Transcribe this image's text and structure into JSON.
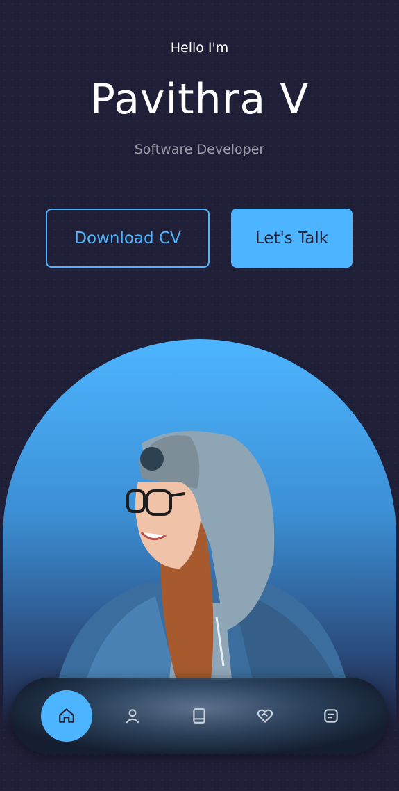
{
  "hero": {
    "greeting": "Hello I'm",
    "name": "Pavithra V",
    "role": "Software Developer"
  },
  "buttons": {
    "download_label": "Download CV",
    "talk_label": "Let's Talk"
  },
  "nav": {
    "items": [
      {
        "icon": "home-icon",
        "active": true
      },
      {
        "icon": "user-icon",
        "active": false
      },
      {
        "icon": "book-icon",
        "active": false
      },
      {
        "icon": "heart-handshake-icon",
        "active": false
      },
      {
        "icon": "message-icon",
        "active": false
      }
    ]
  },
  "colors": {
    "background": "#1f1f38",
    "accent": "#4db5ff",
    "text": "#ffffff"
  }
}
